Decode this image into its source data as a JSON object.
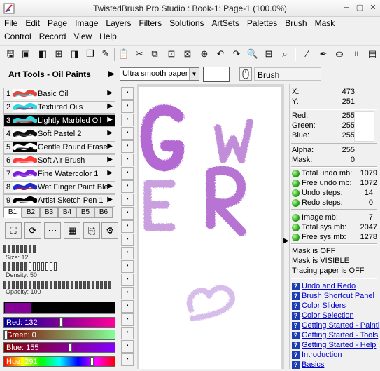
{
  "window": {
    "title": "TwistedBrush Pro Studio : Book-1: Page-1 (100.0%)",
    "minimize": "─",
    "restore": "▢",
    "close": "✕"
  },
  "menu_row1": [
    "File",
    "Edit",
    "Page",
    "Image",
    "Layers",
    "Filters",
    "Solutions",
    "ArtSets",
    "Palettes",
    "Brush",
    "Mask"
  ],
  "menu_row2": [
    "Control",
    "Record",
    "View",
    "Help"
  ],
  "toolbar_icons": [
    "save-icon",
    "save-all-icon",
    "page-prev-icon",
    "page-add-icon",
    "page-next-icon",
    "page-copy-icon",
    "script-icon",
    "paste-icon",
    "cut-icon",
    "copy-icon",
    "stamp-icon",
    "stamp-paste-icon",
    "undo-icon",
    "redo-icon",
    "zoom-icon",
    "fit-icon",
    "zoom-out-icon",
    "brush-icon",
    "eyedropper-icon",
    "bucket-icon",
    "crop-icon"
  ],
  "arttools": {
    "title": "Art Tools - Oil Paints",
    "arrow": "▶"
  },
  "brushes": [
    {
      "num": "1",
      "name": "Basic Oil",
      "color": "#e0463e",
      "accent": "#2ed8e0"
    },
    {
      "num": "2",
      "name": "Textured Oils",
      "color": "#2ed8e0",
      "accent": "#c02070"
    },
    {
      "num": "3",
      "name": "Lightly Marbled Oil",
      "color": "#2ed8e0",
      "accent": "#ff4040"
    },
    {
      "num": "4",
      "name": "Soft Pastel 2",
      "color": "#111111",
      "accent": "#555555"
    },
    {
      "num": "5",
      "name": "Gentle Round Eraser",
      "color": "#ffffff",
      "accent": "#000000"
    },
    {
      "num": "6",
      "name": "Soft Air Brush",
      "color": "#ff3b3b",
      "accent": "#ff9090"
    },
    {
      "num": "7",
      "name": "Fine Watercolor 1",
      "color": "#7a1fd6",
      "accent": "#c060ff"
    },
    {
      "num": "8",
      "name": "Wet Finger Paint Blen",
      "color": "#1a2fd0",
      "accent": "#e01010"
    },
    {
      "num": "9",
      "name": "Artist Sketch Pen 1",
      "color": "#000000",
      "accent": "#ffffff"
    }
  ],
  "selected_brush": "3",
  "banks": [
    "B1",
    "B2",
    "B3",
    "B4",
    "B5",
    "B6"
  ],
  "selected_bank": "B1",
  "sliders": {
    "size": {
      "label": "Size: 12",
      "filled": 8,
      "total": 8
    },
    "density": {
      "label": "Density: 50",
      "filled": 6,
      "total": 13
    },
    "opacity": {
      "label": "Opacity: 100",
      "filled": 26,
      "total": 26
    }
  },
  "current_color": "#840097",
  "color_bars": [
    {
      "label": "Red: 132",
      "value": 132,
      "max": 255,
      "from": "#000098",
      "to": "#ff0098"
    },
    {
      "label": "Green: 0",
      "value": 0,
      "max": 255,
      "from": "#840000",
      "to": "#84ff97"
    },
    {
      "label": "Blue: 155",
      "value": 155,
      "max": 255,
      "from": "#840000",
      "to": "#8400ff"
    },
    {
      "label": "Hue: 291",
      "value": 291,
      "max": 360,
      "from": "rainbow",
      "to": "rainbow"
    }
  ],
  "options": {
    "paper": "Ultra smooth paper",
    "brush_label": "Brush"
  },
  "info": {
    "x_label": "X:",
    "x": "473",
    "y_label": "Y:",
    "y": "251",
    "red_label": "Red:",
    "red": "255",
    "green_label": "Green:",
    "green": "255",
    "blue_label": "Blue:",
    "blue": "255",
    "alpha_label": "Alpha:",
    "alpha": "255",
    "mask_label": "Mask:",
    "mask": "0"
  },
  "stats1": [
    {
      "label": "Total undo mb:",
      "value": "1079"
    },
    {
      "label": "Free undo mb:",
      "value": "1072"
    },
    {
      "label": "Undo steps:",
      "value": "14"
    },
    {
      "label": "Redo steps:",
      "value": "0"
    }
  ],
  "stats2": [
    {
      "label": "Image mb:",
      "value": "7"
    },
    {
      "label": "Total sys mb:",
      "value": "2047"
    },
    {
      "label": "Free sys mb:",
      "value": "1278"
    }
  ],
  "status_lines": [
    "Mask is OFF",
    "Mask is VISIBLE",
    "Tracing paper is OFF"
  ],
  "help_links": [
    "Undo and Redo",
    "Brush Shortcut Panel",
    "Color Sliders",
    "Color Selection",
    "Getting Started - Painti",
    "Getting Started - Tools",
    "Getting Started - Help",
    "Introduction",
    "Basics"
  ],
  "canvas_letters": [
    "G",
    "W",
    "E",
    "R"
  ]
}
